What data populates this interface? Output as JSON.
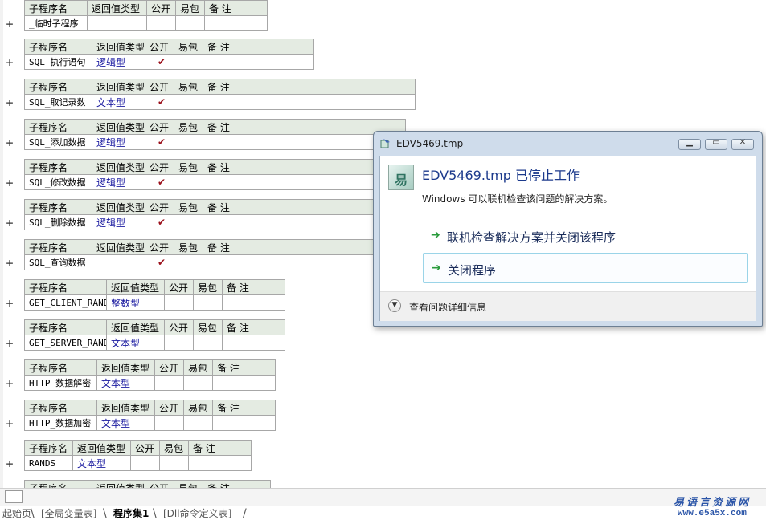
{
  "table_headers": {
    "name": "子程序名",
    "return_type": "返回值类型",
    "public": "公开",
    "easy_pkg": "易包",
    "note": "备 注"
  },
  "check_mark": "✔",
  "subprograms": [
    {
      "name": "_临时子程序",
      "return_type": "",
      "public": false
    },
    {
      "name": "SQL_执行语句",
      "return_type": "逻辑型",
      "public": true
    },
    {
      "name": "SQL_取记录数",
      "return_type": "文本型",
      "public": true
    },
    {
      "name": "SQL_添加数据",
      "return_type": "逻辑型",
      "public": true
    },
    {
      "name": "SQL_修改数据",
      "return_type": "逻辑型",
      "public": true
    },
    {
      "name": "SQL_删除数据",
      "return_type": "逻辑型",
      "public": true
    },
    {
      "name": "SQL_查询数据",
      "return_type": "",
      "public": true
    },
    {
      "name": "GET_CLIENT_RAND",
      "return_type": "整数型",
      "public": false
    },
    {
      "name": "GET_SERVER_RAND",
      "return_type": "文本型",
      "public": false
    },
    {
      "name": "HTTP_数据解密",
      "return_type": "文本型",
      "public": false
    },
    {
      "name": "HTTP_数据加密",
      "return_type": "文本型",
      "public": false
    },
    {
      "name": "RANDS",
      "return_type": "文本型",
      "public": false
    }
  ],
  "expand_symbol": "+",
  "tabs": [
    {
      "label": "起始页",
      "active": false
    },
    {
      "label": "[全局变量表]",
      "active": false
    },
    {
      "label": "程序集1",
      "active": true
    },
    {
      "label": "[Dll命令定义表]",
      "active": false
    }
  ],
  "watermark": {
    "name": "易语言资源网",
    "url": "www.e5a5x.com"
  },
  "dialog": {
    "title": "EDV5469.tmp",
    "heading": "EDV5469.tmp 已停止工作",
    "description": "Windows 可以联机检查该问题的解决方案。",
    "option_online": "联机检查解决方案并关闭该程序",
    "option_close": "关闭程序",
    "details": "查看问题详细信息"
  },
  "colors": {
    "header_bg": "#e4ebe2",
    "return_type_text": "#1a1aa0",
    "check_mark": "#9b0f1a",
    "dialog_heading": "#1c3a8c",
    "arrow": "#2a9b3c"
  }
}
